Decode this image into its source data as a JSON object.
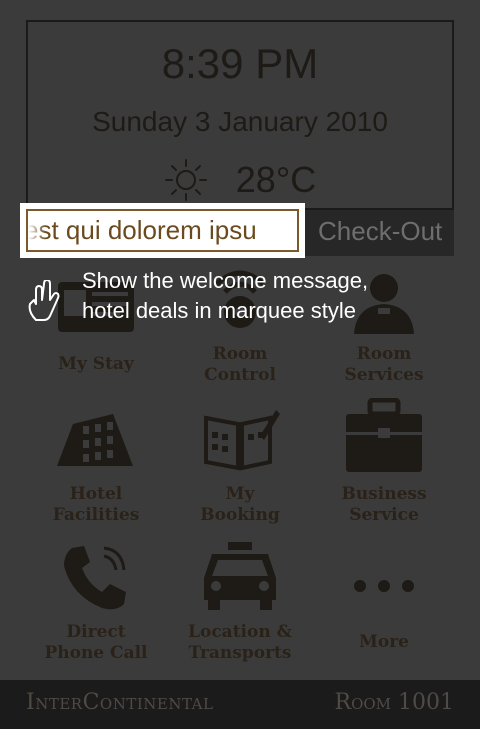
{
  "clock": {
    "time": "8:39 PM",
    "date": "Sunday 3 January 2010",
    "temperature": "28°C",
    "weather_icon": "sun-icon"
  },
  "marquee": {
    "text": "est qui dolorem ipsu"
  },
  "checkout_label": "Check-Out",
  "hint": {
    "line1": "Show the welcome message,",
    "line2": "hotel deals in marquee style",
    "icon": "tap-hand-icon"
  },
  "menu": [
    {
      "label": "My Stay",
      "icon": "id-card-icon"
    },
    {
      "label": "Room\nControl",
      "icon": "room-control-icon"
    },
    {
      "label": "Room\nServices",
      "icon": "room-service-icon"
    },
    {
      "label": "Hotel\nFacilities",
      "icon": "hotel-building-icon"
    },
    {
      "label": "My\nBooking",
      "icon": "booking-book-icon"
    },
    {
      "label": "Business\nService",
      "icon": "briefcase-icon"
    },
    {
      "label": "Direct\nPhone Call",
      "icon": "phone-icon"
    },
    {
      "label": "Location &\nTransports",
      "icon": "taxi-icon"
    },
    {
      "label": "More",
      "icon": "more-dots-icon"
    }
  ],
  "footer": {
    "brand": "InterContinental",
    "room": "Room 1001"
  },
  "colors": {
    "background": "#3b3b3b",
    "icon": "#1e1a16",
    "label": "#2a2218",
    "marquee_text": "#6b4a1f",
    "footer_bg": "#1b1b1b"
  }
}
